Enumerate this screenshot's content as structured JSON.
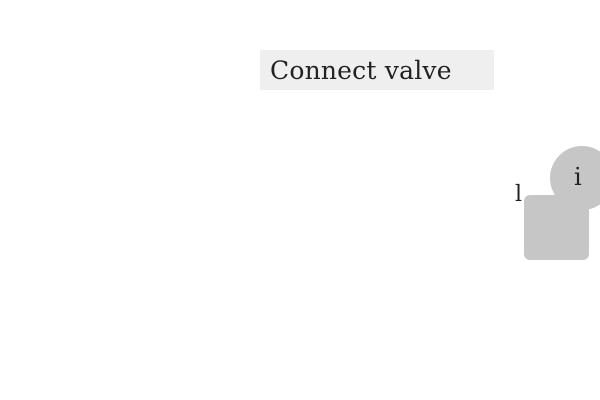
{
  "title": {
    "text": "Connect valve"
  },
  "side_label": {
    "text": "l"
  },
  "info_button": {
    "glyph": "i",
    "icon": "info-icon"
  },
  "colors": {
    "background": "#ffffff",
    "title_box": "#efefef",
    "button_gray": "#c6c6c6",
    "text": "#222222"
  }
}
